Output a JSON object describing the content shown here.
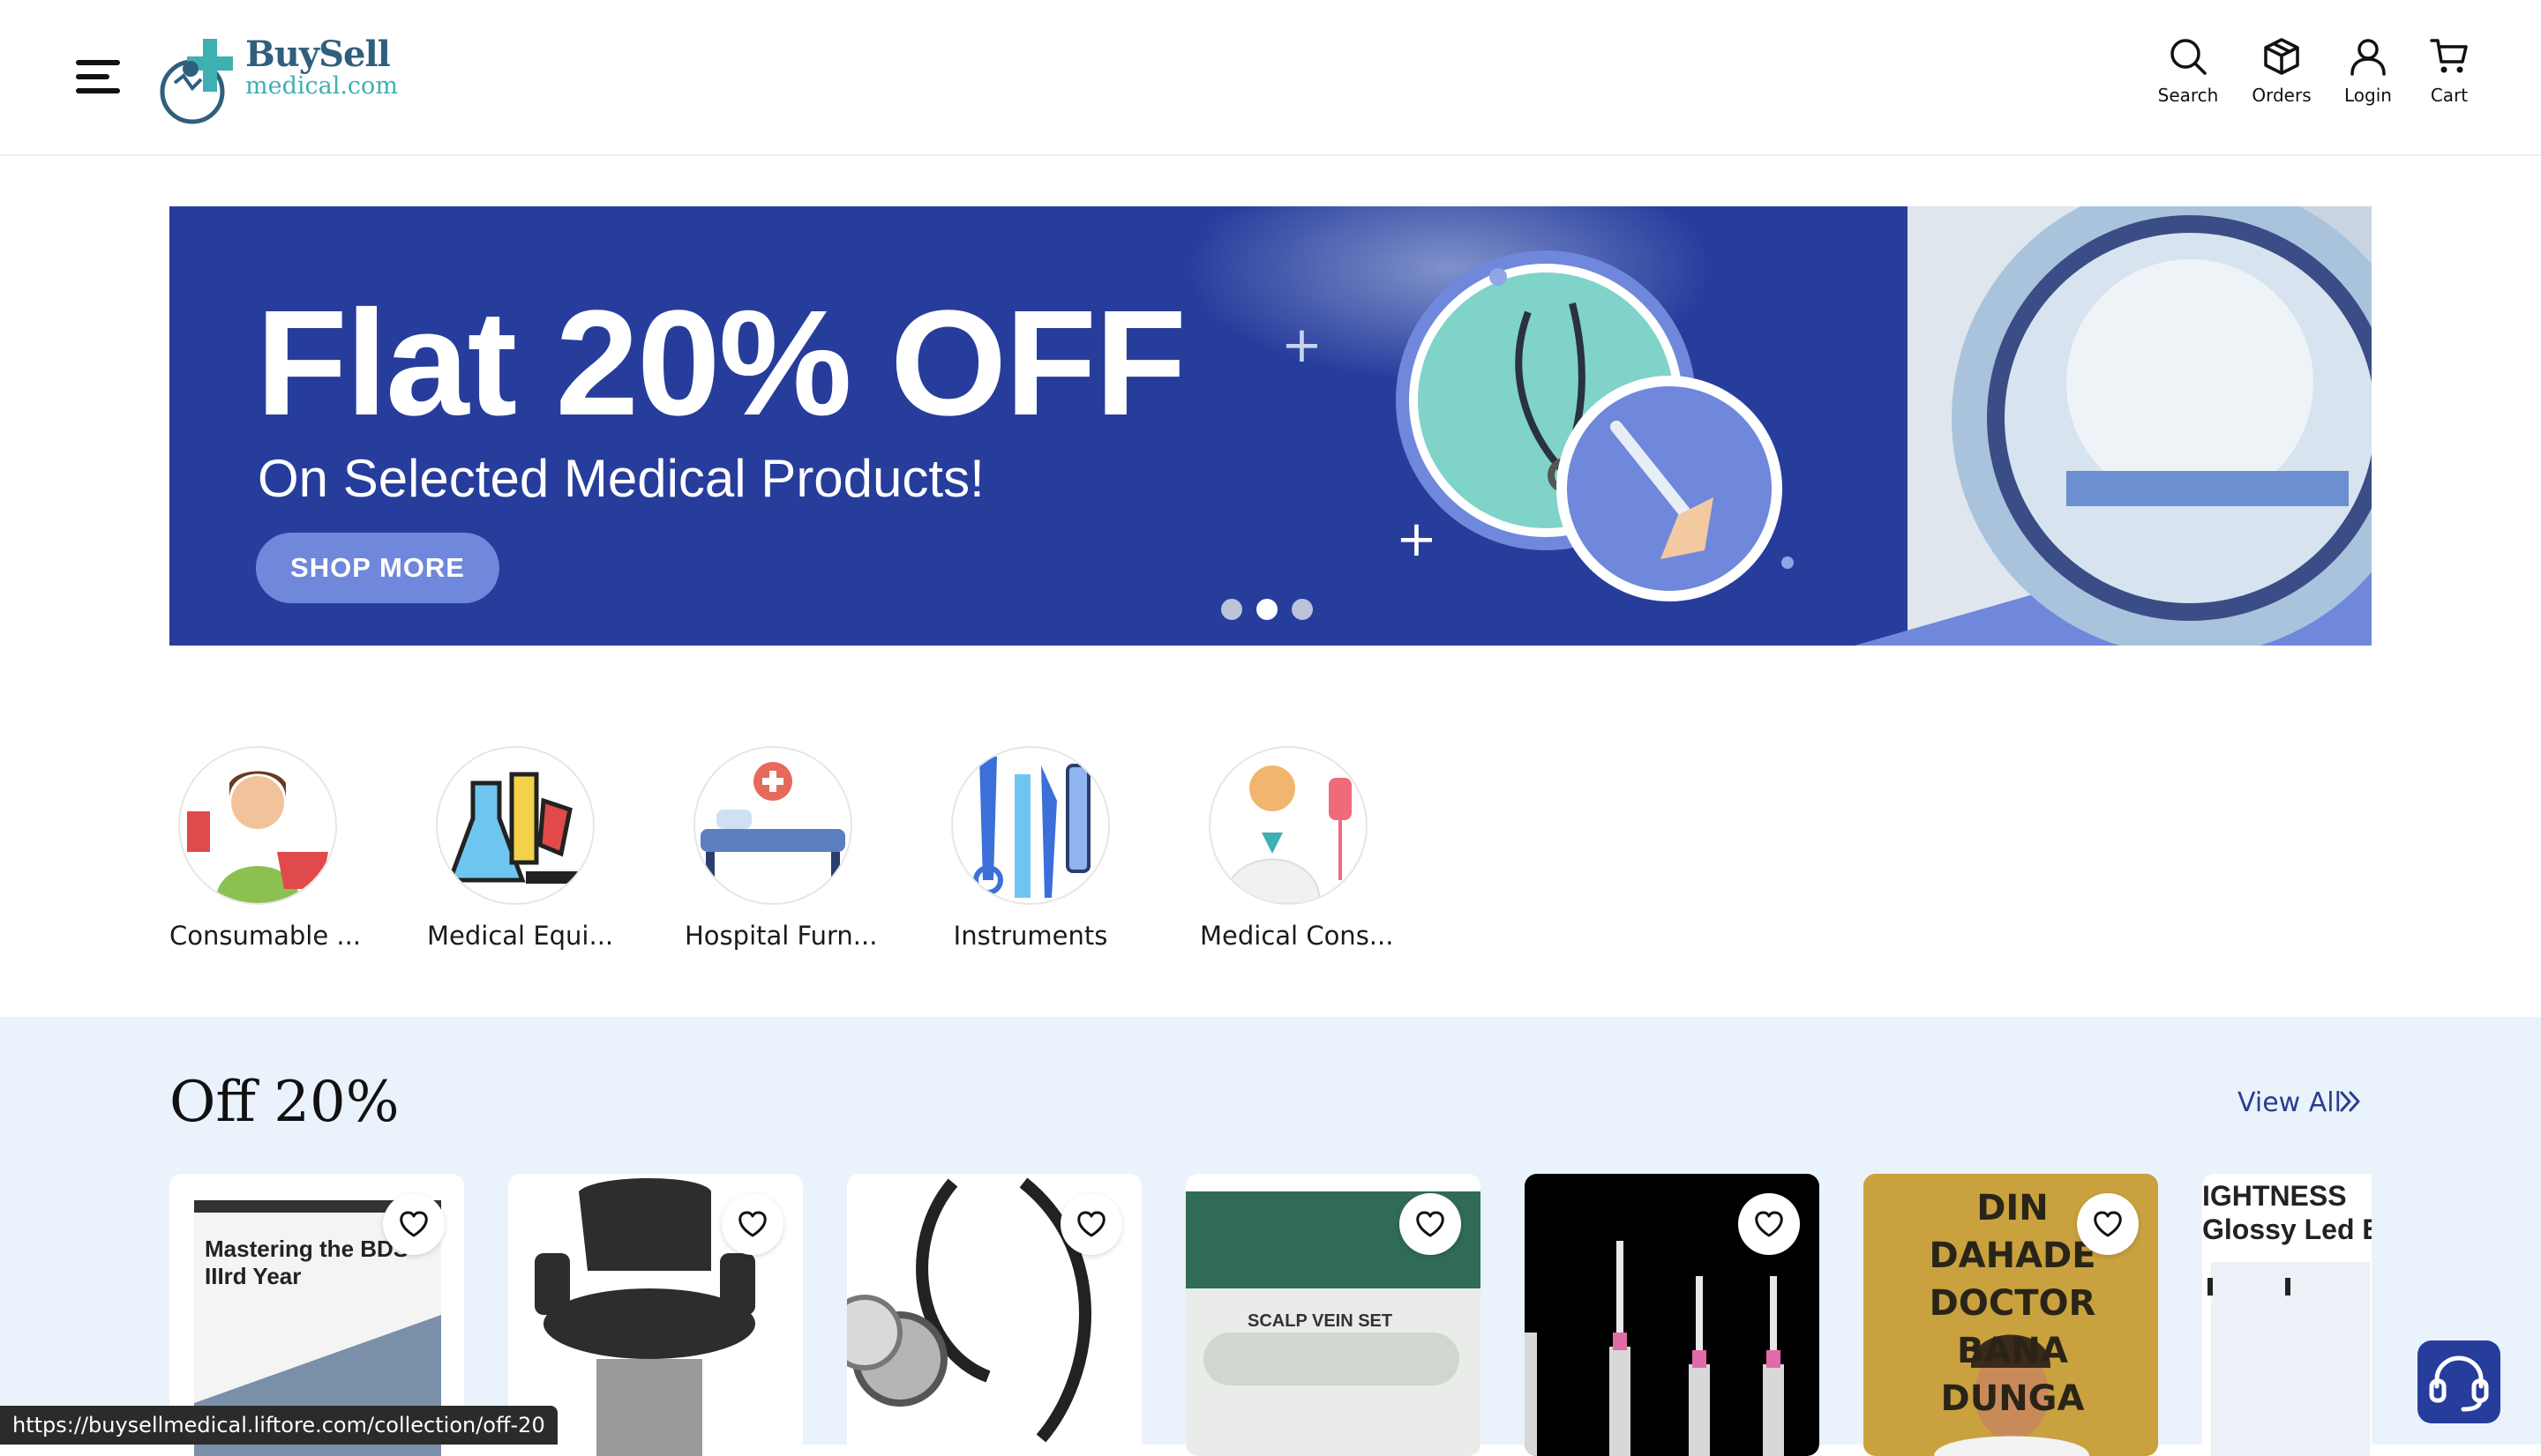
{
  "header": {
    "logo": {
      "line1": "BuySell",
      "line2": "medical.com"
    },
    "actions": [
      {
        "label": "Search",
        "icon": "search-icon"
      },
      {
        "label": "Orders",
        "icon": "box-icon"
      },
      {
        "label": "Login",
        "icon": "user-icon"
      },
      {
        "label": "Cart",
        "icon": "cart-icon"
      }
    ]
  },
  "banner": {
    "title": "Flat 20% OFF",
    "subtitle": "On Selected Medical Products!",
    "button": "SHOP MORE",
    "slides": 3,
    "active_slide": 2
  },
  "categories": [
    {
      "label": "Consumable ..."
    },
    {
      "label": "Medical Equi..."
    },
    {
      "label": "Hospital Furn..."
    },
    {
      "label": "Instruments"
    },
    {
      "label": "Medical Cons..."
    }
  ],
  "collection": {
    "title": "Off 20%",
    "view_all": "View All",
    "products": [
      {
        "image_text": "Mastering the BDS IIIrd Year"
      },
      {
        "image_text": ""
      },
      {
        "image_text": ""
      },
      {
        "image_text": "SCALP VEIN SET"
      },
      {
        "image_text": ""
      },
      {
        "image_text": "DIN DAHADE DOCTOR BANA DUNGA"
      },
      {
        "image_text": "IGHTNESS Glossy Led Bu"
      }
    ]
  },
  "status_bar": {
    "url": "https://buysellmedical.liftore.com/collection/off-20"
  },
  "colors": {
    "brand": "#273d9c",
    "section_bg": "#eaf2fb",
    "button": "#6f88dc"
  }
}
